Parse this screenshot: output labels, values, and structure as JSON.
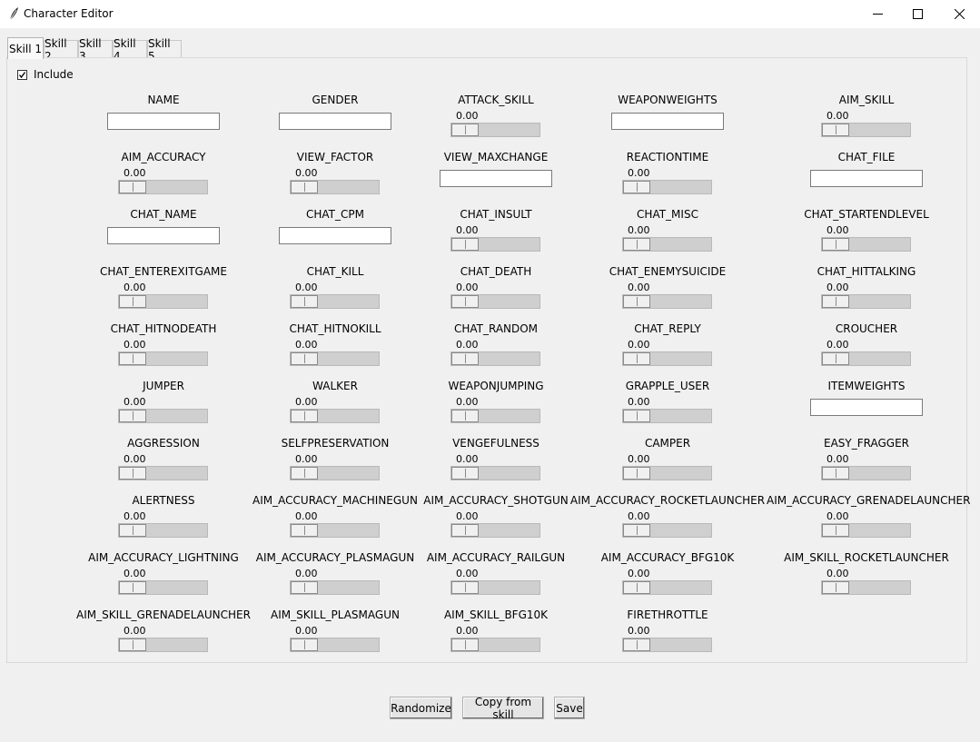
{
  "window": {
    "title": "Character Editor",
    "controls": [
      "minimize-icon",
      "maximize-icon",
      "close-icon"
    ]
  },
  "tabs": [
    "Skill 1",
    "Skill 2",
    "Skill 3",
    "Skill 4",
    "Skill 5"
  ],
  "active_tab": "Skill 1",
  "include": {
    "label": "Include",
    "checked": true
  },
  "fields": [
    {
      "label": "NAME",
      "type": "entry",
      "value": ""
    },
    {
      "label": "GENDER",
      "type": "entry",
      "value": ""
    },
    {
      "label": "ATTACK_SKILL",
      "type": "scale",
      "value": "0.00"
    },
    {
      "label": "WEAPONWEIGHTS",
      "type": "entry",
      "value": ""
    },
    {
      "label": "AIM_SKILL",
      "type": "scale",
      "value": "0.00"
    },
    {
      "label": "AIM_ACCURACY",
      "type": "scale",
      "value": "0.00"
    },
    {
      "label": "VIEW_FACTOR",
      "type": "scale",
      "value": "0.00"
    },
    {
      "label": "VIEW_MAXCHANGE",
      "type": "entry",
      "value": ""
    },
    {
      "label": "REACTIONTIME",
      "type": "scale",
      "value": "0.00"
    },
    {
      "label": "CHAT_FILE",
      "type": "entry",
      "value": ""
    },
    {
      "label": "CHAT_NAME",
      "type": "entry",
      "value": ""
    },
    {
      "label": "CHAT_CPM",
      "type": "entry",
      "value": ""
    },
    {
      "label": "CHAT_INSULT",
      "type": "scale",
      "value": "0.00"
    },
    {
      "label": "CHAT_MISC",
      "type": "scale",
      "value": "0.00"
    },
    {
      "label": "CHAT_STARTENDLEVEL",
      "type": "scale",
      "value": "0.00"
    },
    {
      "label": "CHAT_ENTEREXITGAME",
      "type": "scale",
      "value": "0.00"
    },
    {
      "label": "CHAT_KILL",
      "type": "scale",
      "value": "0.00"
    },
    {
      "label": "CHAT_DEATH",
      "type": "scale",
      "value": "0.00"
    },
    {
      "label": "CHAT_ENEMYSUICIDE",
      "type": "scale",
      "value": "0.00"
    },
    {
      "label": "CHAT_HITTALKING",
      "type": "scale",
      "value": "0.00"
    },
    {
      "label": "CHAT_HITNODEATH",
      "type": "scale",
      "value": "0.00"
    },
    {
      "label": "CHAT_HITNOKILL",
      "type": "scale",
      "value": "0.00"
    },
    {
      "label": "CHAT_RANDOM",
      "type": "scale",
      "value": "0.00"
    },
    {
      "label": "CHAT_REPLY",
      "type": "scale",
      "value": "0.00"
    },
    {
      "label": "CROUCHER",
      "type": "scale",
      "value": "0.00"
    },
    {
      "label": "JUMPER",
      "type": "scale",
      "value": "0.00"
    },
    {
      "label": "WALKER",
      "type": "scale",
      "value": "0.00"
    },
    {
      "label": "WEAPONJUMPING",
      "type": "scale",
      "value": "0.00"
    },
    {
      "label": "GRAPPLE_USER",
      "type": "scale",
      "value": "0.00"
    },
    {
      "label": "ITEMWEIGHTS",
      "type": "entry",
      "value": ""
    },
    {
      "label": "AGGRESSION",
      "type": "scale",
      "value": "0.00"
    },
    {
      "label": "SELFPRESERVATION",
      "type": "scale",
      "value": "0.00"
    },
    {
      "label": "VENGEFULNESS",
      "type": "scale",
      "value": "0.00"
    },
    {
      "label": "CAMPER",
      "type": "scale",
      "value": "0.00"
    },
    {
      "label": "EASY_FRAGGER",
      "type": "scale",
      "value": "0.00"
    },
    {
      "label": "ALERTNESS",
      "type": "scale",
      "value": "0.00"
    },
    {
      "label": "AIM_ACCURACY_MACHINEGUN",
      "type": "scale",
      "value": "0.00"
    },
    {
      "label": "AIM_ACCURACY_SHOTGUN",
      "type": "scale",
      "value": "0.00"
    },
    {
      "label": "AIM_ACCURACY_ROCKETLAUNCHER",
      "type": "scale",
      "value": "0.00"
    },
    {
      "label": "AIM_ACCURACY_GRENADELAUNCHER",
      "type": "scale",
      "value": "0.00"
    },
    {
      "label": "AIM_ACCURACY_LIGHTNING",
      "type": "scale",
      "value": "0.00"
    },
    {
      "label": "AIM_ACCURACY_PLASMAGUN",
      "type": "scale",
      "value": "0.00"
    },
    {
      "label": "AIM_ACCURACY_RAILGUN",
      "type": "scale",
      "value": "0.00"
    },
    {
      "label": "AIM_ACCURACY_BFG10K",
      "type": "scale",
      "value": "0.00"
    },
    {
      "label": "AIM_SKILL_ROCKETLAUNCHER",
      "type": "scale",
      "value": "0.00"
    },
    {
      "label": "AIM_SKILL_GRENADELAUNCHER",
      "type": "scale",
      "value": "0.00"
    },
    {
      "label": "AIM_SKILL_PLASMAGUN",
      "type": "scale",
      "value": "0.00"
    },
    {
      "label": "AIM_SKILL_BFG10K",
      "type": "scale",
      "value": "0.00"
    },
    {
      "label": "FIRETHROTTLE",
      "type": "scale",
      "value": "0.00"
    }
  ],
  "buttons": {
    "randomize": "Randomize",
    "copy": "Copy from skill",
    "save": "Save"
  }
}
